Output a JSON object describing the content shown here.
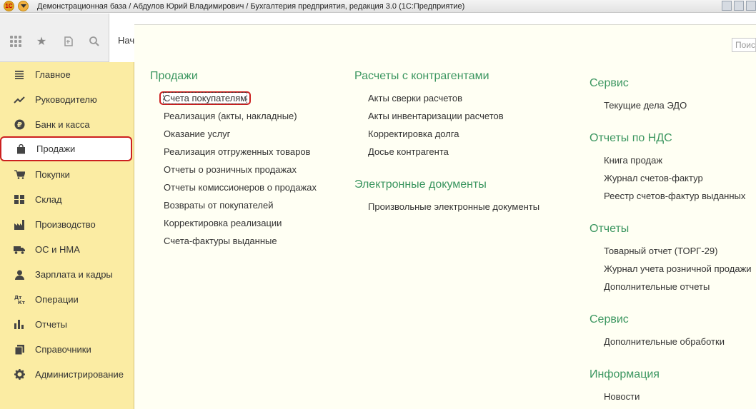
{
  "window": {
    "app_icon": "1C",
    "title": "Демонстрационная база / Абдулов Юрий Владимирович / Бухгалтерия предприятия, редакция 3.0  (1С:Предприятие)"
  },
  "toolbar": {
    "start_tab": "Нач",
    "search_placeholder": "Поис"
  },
  "sidebar": {
    "items": [
      {
        "label": "Главное",
        "icon": "menu-lines-icon"
      },
      {
        "label": "Руководителю",
        "icon": "trend-up-icon"
      },
      {
        "label": "Банк и касса",
        "icon": "ruble-coin-icon"
      },
      {
        "label": "Продажи",
        "icon": "shopping-bag-icon",
        "active": true
      },
      {
        "label": "Покупки",
        "icon": "cart-icon"
      },
      {
        "label": "Склад",
        "icon": "warehouse-icon"
      },
      {
        "label": "Производство",
        "icon": "factory-icon"
      },
      {
        "label": "ОС и НМА",
        "icon": "truck-icon"
      },
      {
        "label": "Зарплата и кадры",
        "icon": "person-icon"
      },
      {
        "label": "Операции",
        "icon": "debit-credit-icon"
      },
      {
        "label": "Отчеты",
        "icon": "bar-chart-icon"
      },
      {
        "label": "Справочники",
        "icon": "books-icon"
      },
      {
        "label": "Администрирование",
        "icon": "gear-icon"
      }
    ]
  },
  "sections": {
    "sales": {
      "title": "Продажи",
      "links": [
        "Счета покупателям",
        "Реализация (акты, накладные)",
        "Оказание услуг",
        "Реализация отгруженных товаров",
        "Отчеты о розничных продажах",
        "Отчеты комиссионеров о продажах",
        "Возвраты от покупателей",
        "Корректировка реализации",
        "Счета-фактуры выданные"
      ]
    },
    "settlements": {
      "title": "Расчеты с контрагентами",
      "links": [
        "Акты сверки расчетов",
        "Акты инвентаризации расчетов",
        "Корректировка долга",
        "Досье контрагента"
      ]
    },
    "edocs": {
      "title": "Электронные документы",
      "links": [
        "Произвольные электронные документы"
      ]
    },
    "service1": {
      "title": "Сервис",
      "links": [
        "Текущие дела ЭДО"
      ]
    },
    "vat": {
      "title": "Отчеты по НДС",
      "links": [
        "Книга продаж",
        "Журнал счетов-фактур",
        "Реестр счетов-фактур выданных"
      ]
    },
    "reports": {
      "title": "Отчеты",
      "links": [
        "Товарный отчет (ТОРГ-29)",
        "Журнал учета розничной продажи",
        "Дополнительные отчеты"
      ]
    },
    "service2": {
      "title": "Сервис",
      "links": [
        "Дополнительные обработки"
      ]
    },
    "info": {
      "title": "Информация",
      "links": [
        "Новости"
      ]
    }
  },
  "colors": {
    "sidebar_bg": "#fbeca3",
    "section_title": "#3b9660",
    "highlight_border": "#cc2020"
  }
}
